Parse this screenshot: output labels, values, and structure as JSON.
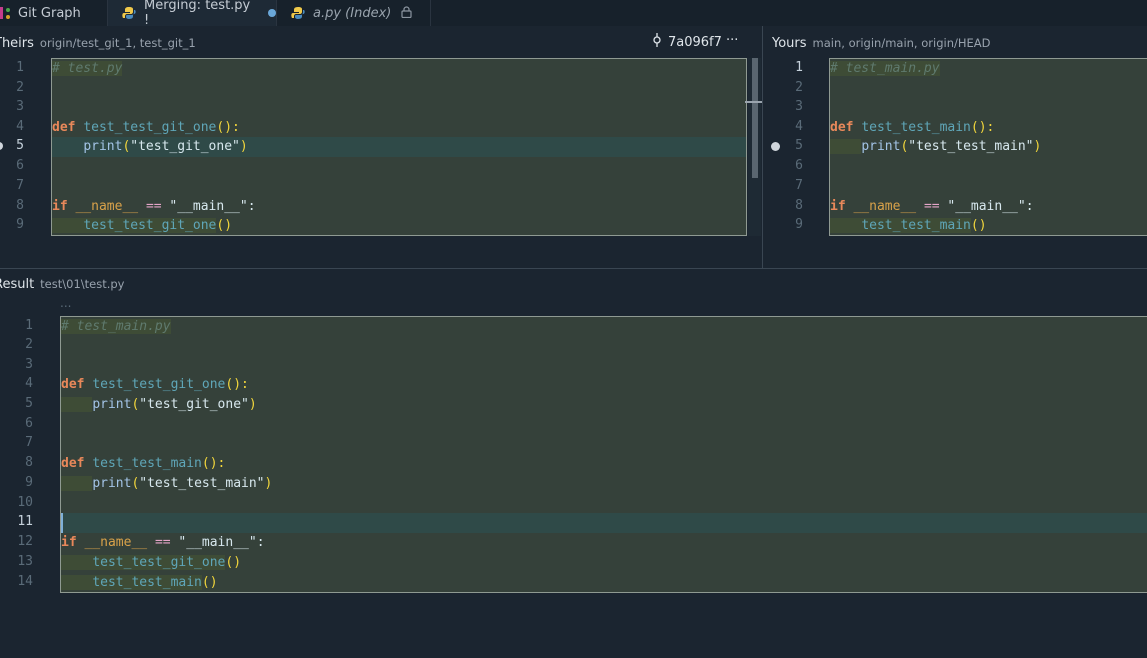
{
  "tabs": [
    {
      "label": "Git Graph"
    },
    {
      "label": "Merging: test.py !"
    },
    {
      "label": "a.py (Index)"
    }
  ],
  "theirs": {
    "title": "Theirs",
    "subtitle": "origin/test_git_1, test_git_1",
    "commit": "7a096f7",
    "more": "···",
    "line_numbers": [
      "1",
      "2",
      "3",
      "4",
      "5",
      "6",
      "7",
      "8",
      "9"
    ]
  },
  "yours": {
    "title": "Yours",
    "subtitle": "main, origin/main, origin/HEAD",
    "line_numbers": [
      "1",
      "2",
      "3",
      "4",
      "5",
      "6",
      "7",
      "8",
      "9"
    ]
  },
  "result": {
    "title": "Result",
    "subtitle": "test\\01\\test.py",
    "fold": "...",
    "line_numbers": [
      "1",
      "2",
      "3",
      "4",
      "5",
      "6",
      "7",
      "8",
      "9",
      "10",
      "11",
      "12",
      "13",
      "14"
    ]
  },
  "code": {
    "theirs_comment": "# test.py",
    "yours_comment": "# test_main.py",
    "result_comment": "# test_main.py",
    "kw_def": "def",
    "kw_if": "if",
    "fn_git_one": "test_test_git_one",
    "fn_main": "test_test_main",
    "print": "print",
    "str_git_one": "\"test_git_one\"",
    "str_main": "\"test_test_main\"",
    "dunder_name": "__name__",
    "eqeq": "==",
    "str_dmain": "\"__main__\"",
    "colon": ":",
    "paren_def": "():",
    "paren_open": "(",
    "paren_close": ")",
    "paren_call": "()"
  },
  "colors": {
    "accent": "#6aa7d8",
    "conflict_bg": "#35413a",
    "keyword": "#e8885a",
    "function": "#5fa6b8"
  }
}
